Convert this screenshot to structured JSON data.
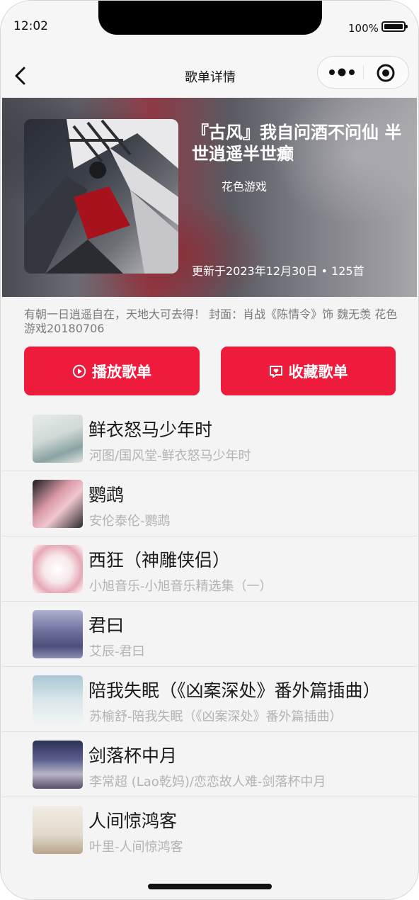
{
  "status_bar": {
    "time": "12:02",
    "battery": "100%"
  },
  "nav": {
    "title": "歌单详情",
    "back_icon": "chevron-left-icon",
    "more_icon": "more-dots-icon",
    "close_icon": "target-close-icon"
  },
  "playlist": {
    "title": "『古风』我自问酒不问仙 半世逍遥半世癫",
    "creator": "花色游戏",
    "meta": "更新于2023年12月30日 • 125首",
    "description": "有朝一日逍遥自在，天地大可去得！ 封面：肖战《陈情令》饰 魏无羡 花色游戏20180706"
  },
  "actions": {
    "play_label": "播放歌单",
    "collect_label": "收藏歌单",
    "accent_color": "#ee1b3c"
  },
  "songs": [
    {
      "name": "鲜衣怒马少年时",
      "subtitle": "河图/国风堂-鲜衣怒马少年时"
    },
    {
      "name": "鹦鹉",
      "subtitle": "安伦泰伦-鹦鹉"
    },
    {
      "name": "西狂（神雕侠侣）",
      "subtitle": "小旭音乐-小旭音乐精选集（一）"
    },
    {
      "name": "君曰",
      "subtitle": "艾辰-君曰"
    },
    {
      "name": "陪我失眠（《凶案深处》番外篇插曲）",
      "subtitle": "苏榆舒-陪我失眠（《凶案深处》番外篇插曲）"
    },
    {
      "name": "剑落杯中月",
      "subtitle": "李常超 (Lao乾妈)/恋恋故人难-剑落杯中月"
    },
    {
      "name": "人间惊鸿客",
      "subtitle": "叶里-人间惊鸿客"
    }
  ]
}
